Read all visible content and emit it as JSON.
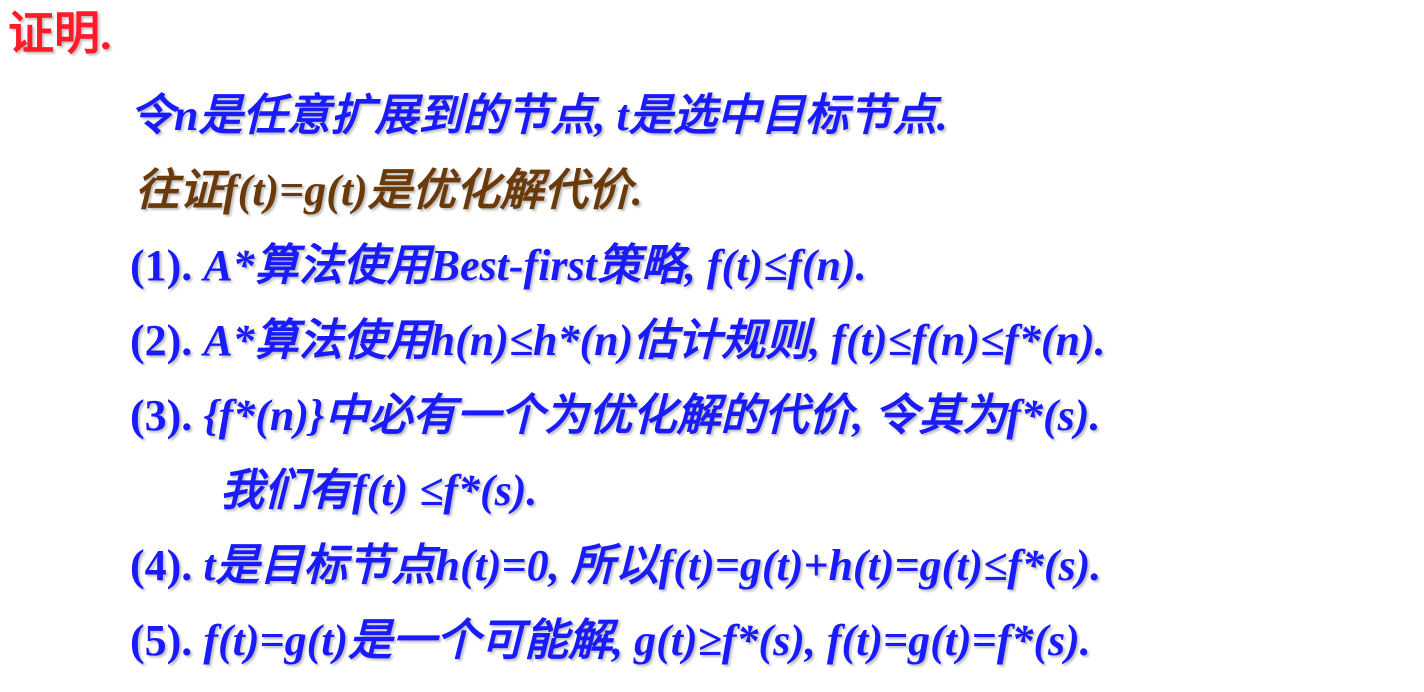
{
  "title": "证明.",
  "colors": {
    "title": "#ff1a2a",
    "body": "#1a1aff",
    "goal": "#6b3a0a"
  },
  "lines": [
    {
      "text": "令n是任意扩展到的节点, t是选中目标节点."
    },
    {
      "text": "往证f(t)=g(t)是优化解代价."
    },
    {
      "num": "(1).",
      "text": "A*算法使用Best-first策略, f(t)≤f(n)."
    },
    {
      "num": "(2).",
      "text": "A*算法使用h(n)≤h*(n)估计规则, f(t)≤f(n)≤f*(n)."
    },
    {
      "num": "(3).",
      "text": "{f*(n)}中必有一个为优化解的代价, 令其为f*(s)."
    },
    {
      "text": "我们有f(t) ≤f*(s)."
    },
    {
      "num": "(4).",
      "text": "t是目标节点h(t)=0, 所以f(t)=g(t)+h(t)=g(t)≤f*(s)."
    },
    {
      "num": "(5).",
      "text": "f(t)=g(t)是一个可能解, g(t)≥f*(s), f(t)=g(t)=f*(s)."
    }
  ]
}
